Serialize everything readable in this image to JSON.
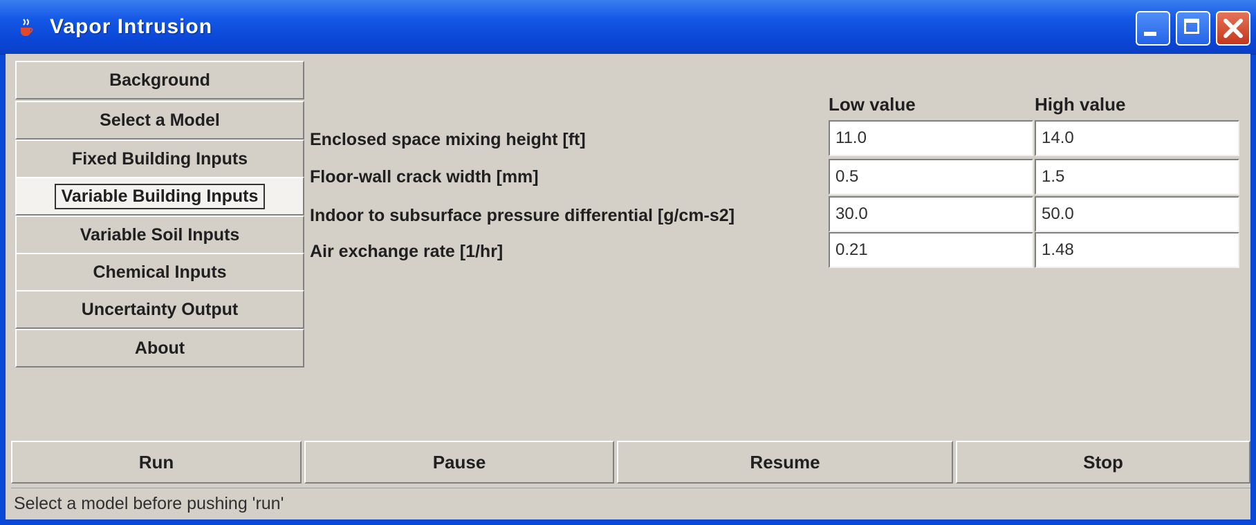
{
  "window": {
    "title": "Vapor Intrusion",
    "title_icon": "java-cup-icon",
    "controls": {
      "minimize": "minimize-icon",
      "maximize": "maximize-icon",
      "close": "close-icon"
    }
  },
  "sidebar": {
    "items": [
      {
        "label": "Background",
        "selected": false
      },
      {
        "label": "Select a Model",
        "selected": false
      },
      {
        "label": "Fixed Building Inputs",
        "selected": false
      },
      {
        "label": "Variable Building Inputs",
        "selected": true
      },
      {
        "label": "Variable Soil Inputs",
        "selected": false
      },
      {
        "label": "Chemical Inputs",
        "selected": false
      },
      {
        "label": "Uncertainty Output",
        "selected": false
      },
      {
        "label": "About",
        "selected": false
      }
    ]
  },
  "inputs": {
    "columns": {
      "low": "Low value",
      "high": "High value"
    },
    "rows": [
      {
        "label": "Enclosed space mixing height [ft]",
        "low": "11.0",
        "high": "14.0"
      },
      {
        "label": "Floor-wall crack width [mm]",
        "low": "0.5",
        "high": "1.5"
      },
      {
        "label": "Indoor to subsurface pressure differential [g/cm-s2]",
        "low": "30.0",
        "high": "50.0"
      },
      {
        "label": "Air exchange rate [1/hr]",
        "low": "0.21",
        "high": "1.48"
      }
    ]
  },
  "actions": {
    "run": "Run",
    "pause": "Pause",
    "resume": "Resume",
    "stop": "Stop"
  },
  "status": {
    "message": "Select a model before pushing 'run'"
  },
  "colors": {
    "title_bar": "#0a48d8",
    "panel": "#d4d0c8",
    "close_button": "#c4371c"
  }
}
